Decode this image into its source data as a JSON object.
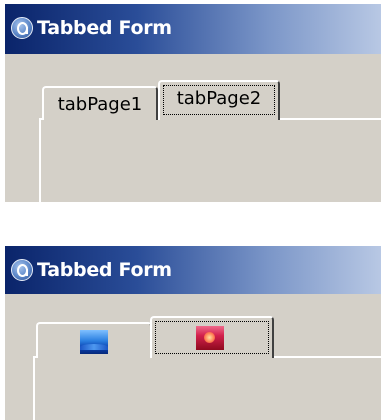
{
  "screens": [
    {
      "window": {
        "title": "Tabbed Form"
      },
      "tabs": [
        {
          "label": "tabPage1",
          "selected": false
        },
        {
          "label": "tabPage2",
          "selected": true,
          "focused": true
        }
      ]
    },
    {
      "window": {
        "title": "Tabbed Form"
      },
      "tabs": [
        {
          "icon": "blue-landscape-icon",
          "selected": false
        },
        {
          "icon": "red-sunset-icon",
          "selected": true,
          "focused": true
        }
      ]
    }
  ],
  "colors": {
    "titlebar_start": "#0a246a",
    "titlebar_end": "#b8c8e4",
    "face": "#d4d0c8",
    "title_text": "#ffffff"
  }
}
